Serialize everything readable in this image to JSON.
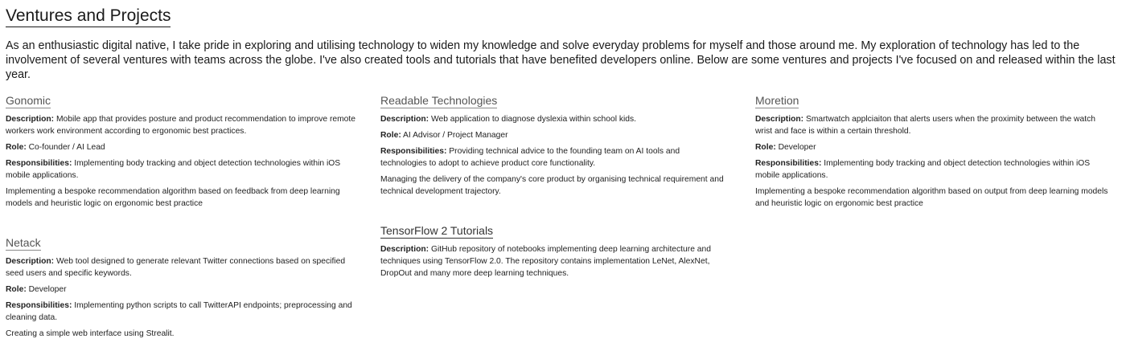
{
  "header": {
    "title": "Ventures and Projects"
  },
  "intro": "As an enthusiastic digital native, I take pride in exploring and utilising technology to widen my knowledge and solve everyday problems for myself and those around me. My exploration of technology has led to the involvement of several ventures with teams across the globe. I've also created tools and tutorials that have benefited developers online. Below are some ventures and projects I've focused on and released within the last year.",
  "labels": {
    "description": "Description:",
    "role": "Role:",
    "responsibilities": "Responsibilities:"
  },
  "projects": {
    "gonomic": {
      "title": "Gonomic",
      "description": "Mobile app that provides posture and product recommendation to improve remote workers work environment according to ergonomic best practices.",
      "role": "Co-founder / AI Lead",
      "responsibilities": "Implementing body tracking and object detection technologies within iOS mobile applications.",
      "note": "Implementing a bespoke recommendation algorithm based on feedback from deep learning models and heuristic logic on ergonomic best practice"
    },
    "readable": {
      "title": "Readable Technologies",
      "description": "Web application to diagnose dyslexia within school kids.",
      "role": "AI Advisor / Project Manager",
      "responsibilities": "Providing technical advice to the founding team on AI tools and technologies to adopt to achieve product core functionality.",
      "note": "Managing the delivery of the company's core product by organising technical requirement and technical development trajectory."
    },
    "moretion": {
      "title": "Moretion",
      "description": "Smartwatch applciaiton that alerts users when the proximity between the watch wrist and face is within a certain threshold.",
      "role": "Developer",
      "responsibilities": "Implementing body tracking and object detection technologies within iOS mobile applications.",
      "note": "Implementing a bespoke recommendation algorithm based on output from deep learning models and heuristic logic on ergonomic best practice"
    },
    "netack": {
      "title": "Netack",
      "description": "Web tool designed to generate relevant Twitter connections based on specified seed users and specific keywords.",
      "role": "Developer",
      "responsibilities": "Implementing python scripts to call TwitterAPI endpoints; preprocessing and cleaning data.",
      "note": "Creating a simple web interface using Strealit."
    },
    "tensorflow": {
      "title": "TensorFlow 2 Tutorials",
      "description": "GitHub repository of notebooks implementing deep learning architecture and techniques using TensorFlow 2.0. The repository contains implementation LeNet, AlexNet, DropOut and many more deep learning techniques."
    }
  }
}
